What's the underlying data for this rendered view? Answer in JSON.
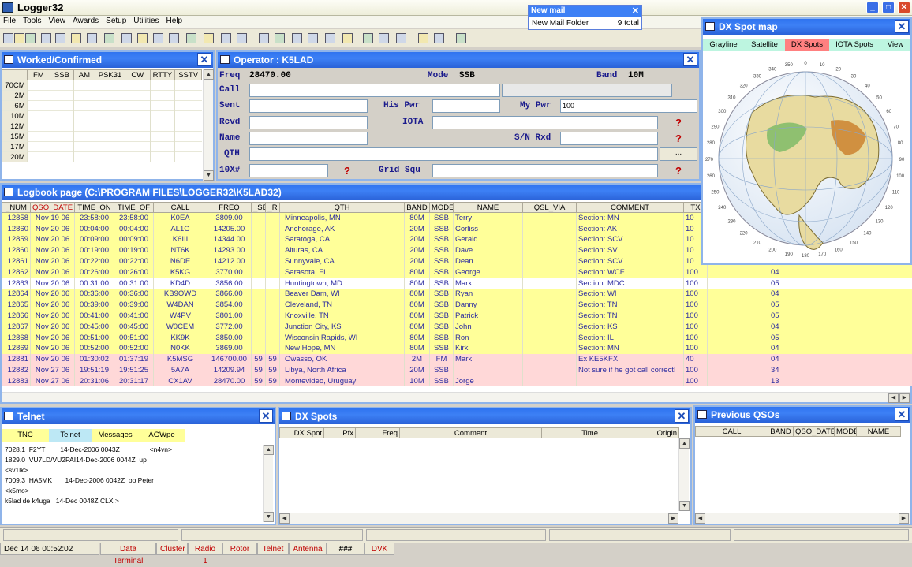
{
  "app": {
    "title": "Logger32"
  },
  "menu": [
    "File",
    "Tools",
    "View",
    "Awards",
    "Setup",
    "Utilities",
    "Help"
  ],
  "newmail": {
    "title": "New mail",
    "folder": "New Mail Folder",
    "count": "9 total"
  },
  "worked": {
    "title": "Worked/Confirmed",
    "cols": [
      "",
      "FM",
      "SSB",
      "AM",
      "PSK31",
      "CW",
      "RTTY",
      "SSTV"
    ],
    "rows": [
      "70CM",
      "2M",
      "6M",
      "10M",
      "12M",
      "15M",
      "17M",
      "20M"
    ]
  },
  "operator": {
    "title": "Operator : K5LAD",
    "freq_label": "Freq",
    "freq": "28470.00",
    "mode_label": "Mode",
    "mode": "SSB",
    "band_label": "Band",
    "band": "10M",
    "call_label": "Call",
    "sent_label": "Sent",
    "hispwr_label": "His Pwr",
    "mypwr_label": "My Pwr",
    "mypwr": "100",
    "rcvd_label": "Rcvd",
    "iota_label": "IOTA",
    "name_label": "Name",
    "snrxd_label": "S/N Rxd",
    "qth_label": "QTH",
    "tenx_label": "10X#",
    "gridsq_label": "Grid Squ",
    "qmark": "?",
    "dots": "..."
  },
  "logbook": {
    "title": "Logbook page (C:\\PROGRAM FILES\\LOGGER32\\K5LAD32)",
    "cols": [
      "_NUM",
      "QSO_DATE",
      "TIME_ON",
      "TIME_OF",
      "CALL",
      "FREQ",
      "_SE",
      "_R",
      "QTH",
      "BAND",
      "MODE",
      "NAME",
      "QSL_VIA",
      "COMMENT",
      "TX",
      ""
    ],
    "rows": [
      {
        "c": [
          "12858",
          "Nov 19 06",
          "23:58:00",
          "23:58:00",
          "K0EA",
          "3809.00",
          "",
          "",
          "Minneapolis, MN",
          "80M",
          "SSB",
          "Terry",
          "",
          "Section: MN",
          "10",
          ""
        ],
        "t": "y"
      },
      {
        "c": [
          "12860",
          "Nov 20 06",
          "00:04:00",
          "00:04:00",
          "AL1G",
          "14205.00",
          "",
          "",
          "Anchorage, AK",
          "20M",
          "SSB",
          "Corliss",
          "",
          "Section: AK",
          "10",
          ""
        ],
        "t": "y"
      },
      {
        "c": [
          "12859",
          "Nov 20 06",
          "00:09:00",
          "00:09:00",
          "K6III",
          "14344.00",
          "",
          "",
          "Saratoga, CA",
          "20M",
          "SSB",
          "Gerald",
          "",
          "Section: SCV",
          "10",
          ""
        ],
        "t": "y"
      },
      {
        "c": [
          "12860",
          "Nov 20 06",
          "00:19:00",
          "00:19:00",
          "NT6K",
          "14293.00",
          "",
          "",
          "Alturas, CA",
          "20M",
          "SSB",
          "Dave",
          "",
          "Section: SV",
          "10",
          ""
        ],
        "t": "y"
      },
      {
        "c": [
          "12861",
          "Nov 20 06",
          "00:22:00",
          "00:22:00",
          "N6DE",
          "14212.00",
          "",
          "",
          "Sunnyvale, CA",
          "20M",
          "SSB",
          "Dean",
          "",
          "Section: SCV",
          "10",
          ""
        ],
        "t": "y"
      },
      {
        "c": [
          "12862",
          "Nov 20 06",
          "00:26:00",
          "00:26:00",
          "K5KG",
          "3770.00",
          "",
          "",
          "Sarasota, FL",
          "80M",
          "SSB",
          "George",
          "",
          "Section: WCF",
          "100",
          "04"
        ],
        "t": "y"
      },
      {
        "c": [
          "12863",
          "Nov 20 06",
          "00:31:00",
          "00:31:00",
          "KD4D",
          "3856.00",
          "",
          "",
          "Huntingtown, MD",
          "80M",
          "SSB",
          "Mark",
          "",
          "Section: MDC",
          "100",
          "05"
        ],
        "t": "w"
      },
      {
        "c": [
          "12864",
          "Nov 20 06",
          "00:36:00",
          "00:36:00",
          "KB9OWD",
          "3866.00",
          "",
          "",
          "Beaver Dam, WI",
          "80M",
          "SSB",
          "Ryan",
          "",
          "Section: WI",
          "100",
          "04"
        ],
        "t": "y"
      },
      {
        "c": [
          "12865",
          "Nov 20 06",
          "00:39:00",
          "00:39:00",
          "W4DAN",
          "3854.00",
          "",
          "",
          "Cleveland, TN",
          "80M",
          "SSB",
          "Danny",
          "",
          "Section: TN",
          "100",
          "05"
        ],
        "t": "y"
      },
      {
        "c": [
          "12866",
          "Nov 20 06",
          "00:41:00",
          "00:41:00",
          "W4PV",
          "3801.00",
          "",
          "",
          "Knoxville, TN",
          "80M",
          "SSB",
          "Patrick",
          "",
          "Section: TN",
          "100",
          "05"
        ],
        "t": "y"
      },
      {
        "c": [
          "12867",
          "Nov 20 06",
          "00:45:00",
          "00:45:00",
          "W0CEM",
          "3772.00",
          "",
          "",
          "Junction City, KS",
          "80M",
          "SSB",
          "John",
          "",
          "Section: KS",
          "100",
          "04"
        ],
        "t": "y"
      },
      {
        "c": [
          "12868",
          "Nov 20 06",
          "00:51:00",
          "00:51:00",
          "KK9K",
          "3850.00",
          "",
          "",
          "Wisconsin Rapids, WI",
          "80M",
          "SSB",
          "Ron",
          "",
          "Section: IL",
          "100",
          "05"
        ],
        "t": "y"
      },
      {
        "c": [
          "12869",
          "Nov 20 06",
          "00:52:00",
          "00:52:00",
          "N0KK",
          "3869.00",
          "",
          "",
          "New Hope, MN",
          "80M",
          "SSB",
          "Kirk",
          "",
          "Section: MN",
          "100",
          "04"
        ],
        "t": "y"
      },
      {
        "c": [
          "12881",
          "Nov 20 06",
          "01:30:02",
          "01:37:19",
          "K5MSG",
          "146700.00",
          "59",
          "59",
          "Owasso, OK",
          "2M",
          "FM",
          "Mark",
          "",
          "Ex KE5KFX",
          "40",
          "04"
        ],
        "t": "p"
      },
      {
        "c": [
          "12882",
          "Nov 27 06",
          "19:51:19",
          "19:51:25",
          "5A7A",
          "14209.94",
          "59",
          "59",
          "Libya, North Africa",
          "20M",
          "SSB",
          "",
          "",
          "Not sure if he got call correct!",
          "100",
          "34"
        ],
        "t": "p"
      },
      {
        "c": [
          "12883",
          "Nov 27 06",
          "20:31:06",
          "20:31:17",
          "CX1AV",
          "28470.00",
          "59",
          "59",
          "Montevideo, Uruguay",
          "10M",
          "SSB",
          "Jorge",
          "",
          "",
          "100",
          "13"
        ],
        "t": "p"
      }
    ]
  },
  "dxmap": {
    "title": "DX Spot map",
    "tabs": [
      "Grayline",
      "Satellite",
      "DX Spots",
      "IOTA Spots",
      "View"
    ],
    "scale": [
      "0",
      "10",
      "20",
      "30",
      "40",
      "50",
      "60",
      "70",
      "80",
      "90",
      "100",
      "110",
      "120",
      "130",
      "140",
      "150",
      "160",
      "170",
      "180",
      "190",
      "200",
      "210",
      "220",
      "230",
      "240",
      "250",
      "260",
      "270",
      "280",
      "290",
      "300",
      "310",
      "320",
      "330",
      "340",
      "350"
    ]
  },
  "telnet": {
    "title": "Telnet",
    "tabs": [
      "TNC",
      "Telnet",
      "Messages",
      "AGWpe"
    ],
    "lines": [
      "7028.1  F2YT        14-Dec-2006 0043Z                <n4vn>",
      "1829.0  VU7LD/VU2PAI14-Dec-2006 0044Z  up",
      "<sv1lk>",
      "7009.3  HA5MK       14-Dec-2006 0042Z  op Peter",
      "<k5mo>",
      "k5lad de k4uga   14-Dec 0048Z CLX >"
    ]
  },
  "dxspots": {
    "title": "DX Spots",
    "cols": [
      "DX Spot",
      "Pfx",
      "Freq",
      "Comment",
      "Time",
      "Origin"
    ]
  },
  "prevqso": {
    "title": "Previous QSOs",
    "cols": [
      "CALL",
      "BAND",
      "QSO_DATE",
      "MODE",
      "NAME"
    ]
  },
  "status": {
    "datetime": "Dec 14 06  00:52:02",
    "items": [
      "Data Terminal",
      "Cluster",
      "Radio 1",
      "Rotor",
      "Telnet",
      "Antenna",
      "###",
      "DVK"
    ]
  },
  "colors": {
    "title_blue": "#2f74f0",
    "row_yellow": "#ffff99",
    "row_pink": "#ffd8d8",
    "status_red": "#c00000"
  }
}
